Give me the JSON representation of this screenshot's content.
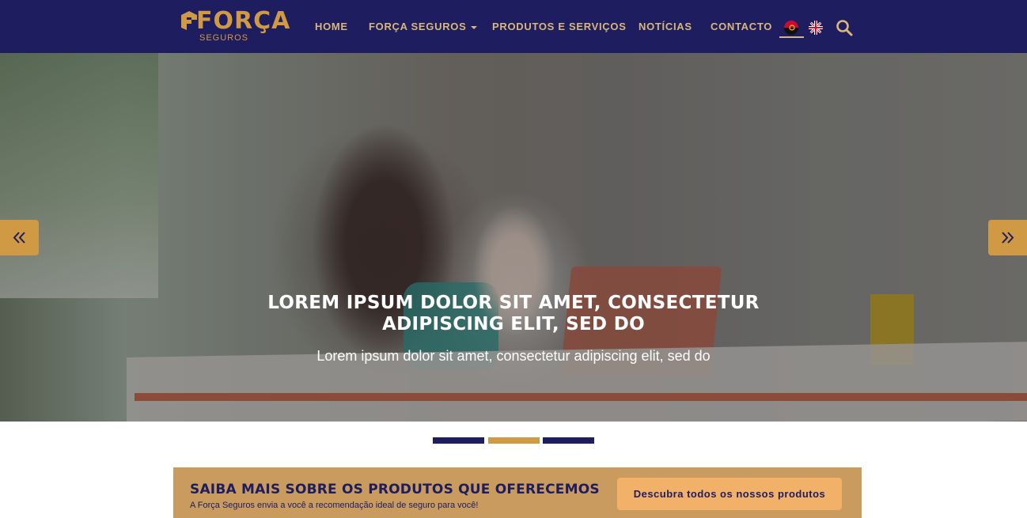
{
  "header": {
    "logo_text": "FORÇA",
    "logo_sub": "SEGUROS",
    "nav": {
      "home": "HOME",
      "forca_seguros": "FORÇA SEGUROS",
      "produtos": "PRODUTOS E SERVIÇOS",
      "noticias": "NOTÍCIAS",
      "contacto": "CONTACTO"
    },
    "languages": [
      "pt-AO",
      "en-GB"
    ],
    "icons": {
      "logo_mark": "forca-logo-icon",
      "search": "search-icon",
      "dropdown": "chevron-down-icon"
    }
  },
  "hero": {
    "title": "LOREM IPSUM DOLOR SIT AMET, CONSECTETUR ADIPISCING ELIT, SED DO",
    "subtitle": "Lorem ipsum dolor sit amet, consectetur adipiscing elit, sed do",
    "prev_icon": "double-chevron-left-icon",
    "next_icon": "double-chevron-right-icon",
    "slides": 3,
    "active_slide": 2
  },
  "cta": {
    "title": "SAIBA MAIS SOBRE OS PRODUTOS QUE OFERECEMOS",
    "subtitle": "A Força Seguros envia a você a recomendação ideal de seguro para você!",
    "button": "Descubra todos os nossos produtos"
  },
  "colors": {
    "navy": "#1d1d60",
    "gold": "#d09a45",
    "nav_text": "#d9b77a",
    "cta_bg": "#c99b5e",
    "cta_button": "#f2b169"
  }
}
